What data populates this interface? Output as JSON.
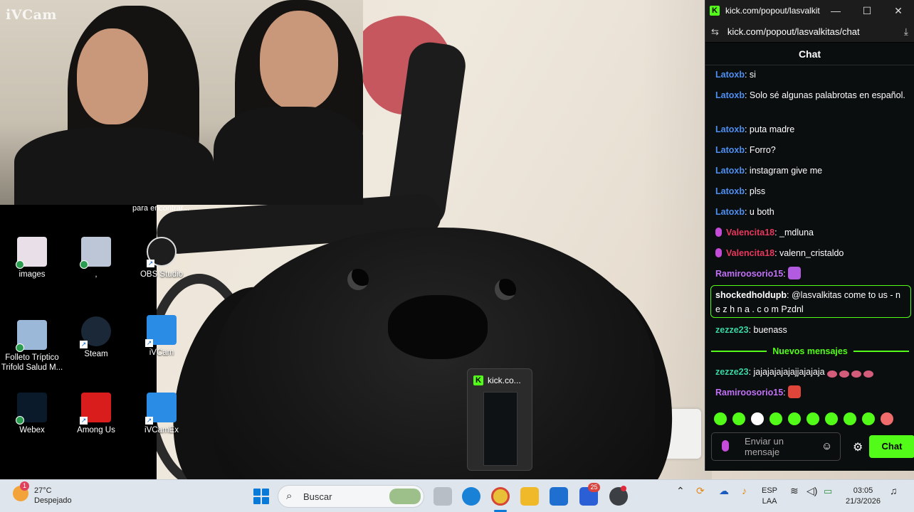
{
  "webcam": {
    "watermark": "iVCam"
  },
  "tooltip": {
    "text": "para encontrar..."
  },
  "desktop": {
    "icons": [
      {
        "label": "images",
        "color": "#e9dfe8"
      },
      {
        "label": ",",
        "color": "#bcc6d6"
      },
      {
        "label": "OBS Studio",
        "color": "#1e1e1e"
      },
      {
        "label": "Folleto Tríptico Trifold Salud M...",
        "color": "#9bb8d9"
      },
      {
        "label": "Steam",
        "color": "#1b2838"
      },
      {
        "label": "iVCam",
        "color": "#2b8ce6"
      },
      {
        "label": "Webex",
        "color": "#0b1a2a"
      },
      {
        "label": "Among Us",
        "color": "#d91c1c"
      },
      {
        "label": "iVCamEx",
        "color": "#2b8ce6"
      }
    ]
  },
  "chat_window": {
    "title": "kick.com/popout/lasvalkitas...",
    "url": "kick.com/popout/lasvalkitas/chat",
    "header": "Chat",
    "messages": [
      {
        "user": "Latoxb",
        "text": ": si",
        "color": "#4d8ff2"
      },
      {
        "user": "Latoxb",
        "text": ": Solo sé algunas palabrotas en español.",
        "color": "#4d8ff2"
      },
      {
        "user": "Latoxb",
        "text": ": puta madre",
        "color": "#4d8ff2"
      },
      {
        "user": "Latoxb",
        "text": ": Forro?",
        "color": "#4d8ff2"
      },
      {
        "user": "Latoxb",
        "text": ": instagram give me",
        "color": "#4d8ff2"
      },
      {
        "user": "Latoxb",
        "text": ": plss",
        "color": "#4d8ff2"
      },
      {
        "user": "Latoxb",
        "text": ": u both",
        "color": "#4d8ff2"
      },
      {
        "user": "Valencita18",
        "text": ": _mdluna",
        "color": "#e8375c",
        "badge": true
      },
      {
        "user": "Valencita18",
        "text": ": valenn_cristaldo",
        "color": "#e8375c",
        "badge": true
      },
      {
        "user": "Ramiroosorio15",
        "text": ":",
        "color": "#c070f5"
      },
      {
        "user": "shockedholdupb",
        "text": ": @lasvalkitas come to us - n e z h n a . c o m Pzdnl",
        "color": "#ffffff"
      },
      {
        "user": "zezze23",
        "text": ": buenass",
        "color": "#39d6a4"
      },
      {
        "user": "zezze23",
        "text": ": jajajajajajajjajajaja",
        "color": "#39d6a4"
      },
      {
        "user": "Ramiroosorio15",
        "text": ":",
        "color": "#c070f5"
      }
    ],
    "new_messages_label": "Nuevos mensajes",
    "input_placeholder": "Enviar un mensaje",
    "send_label": "Chat",
    "accent": "#53fc18"
  },
  "thumbnail": {
    "title": "kick.co..."
  },
  "taskbar": {
    "weather_temp": "27°C",
    "weather_desc": "Despejado",
    "weather_badge": "1",
    "search_label": "Buscar",
    "mail_badge": "25",
    "lang_top": "ESP",
    "lang_bottom": "LAA",
    "time": "03:05",
    "date": "21/3/2026"
  }
}
